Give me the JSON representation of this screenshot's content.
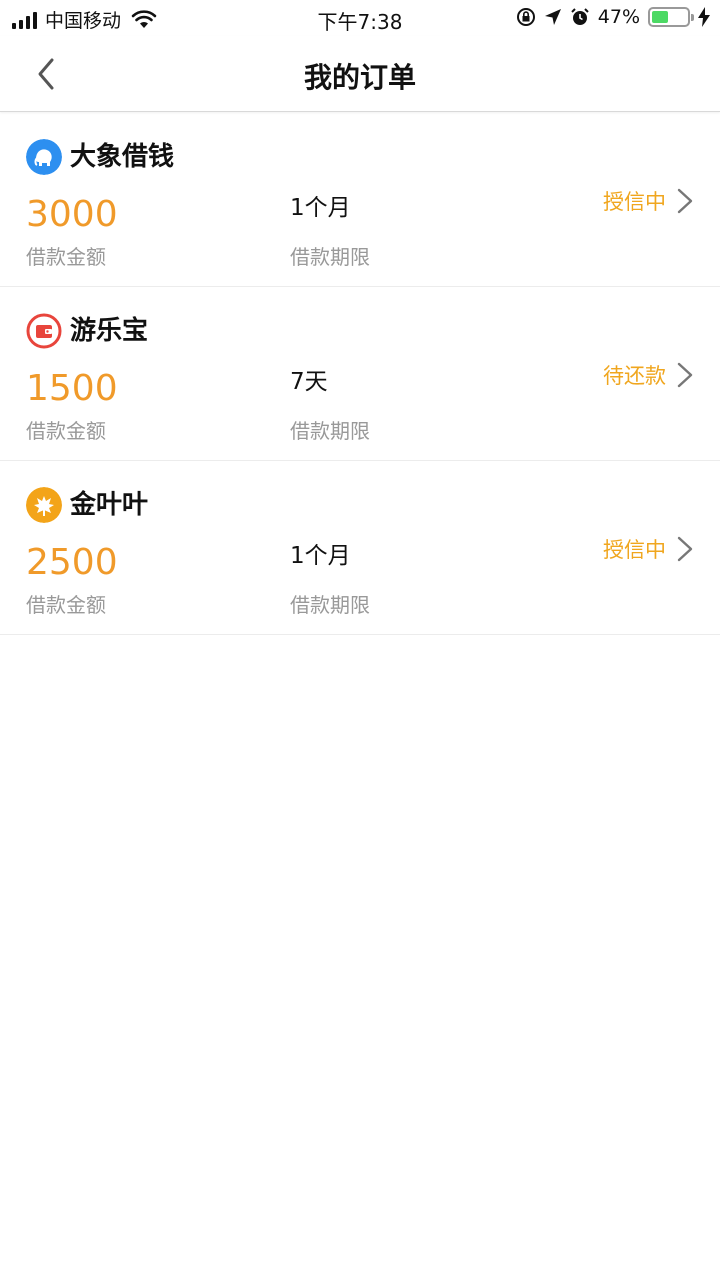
{
  "status_bar": {
    "carrier": "中国移动",
    "time": "下午7:38",
    "battery_percent": "47%",
    "battery_level": 0.47
  },
  "nav": {
    "title": "我的订单",
    "back_icon": "chevron-left-icon"
  },
  "orders": [
    {
      "name": "大象借钱",
      "logo_icon": "elephant-icon",
      "logo_color": "#2d8ff0",
      "amount": "3000",
      "amount_label": "借款金额",
      "term": "1个月",
      "term_label": "借款期限",
      "status": "授信中"
    },
    {
      "name": "游乐宝",
      "logo_icon": "wallet-icon",
      "logo_color": "#e8453c",
      "amount": "1500",
      "amount_label": "借款金额",
      "term": "7天",
      "term_label": "借款期限",
      "status": "待还款"
    },
    {
      "name": "金叶叶",
      "logo_icon": "leaf-icon",
      "logo_color": "#f3a419",
      "amount": "2500",
      "amount_label": "借款金额",
      "term": "1个月",
      "term_label": "借款期限",
      "status": "授信中"
    }
  ],
  "colors": {
    "amount": "#f09a2a",
    "status": "#f0a61e",
    "label": "#999999"
  }
}
